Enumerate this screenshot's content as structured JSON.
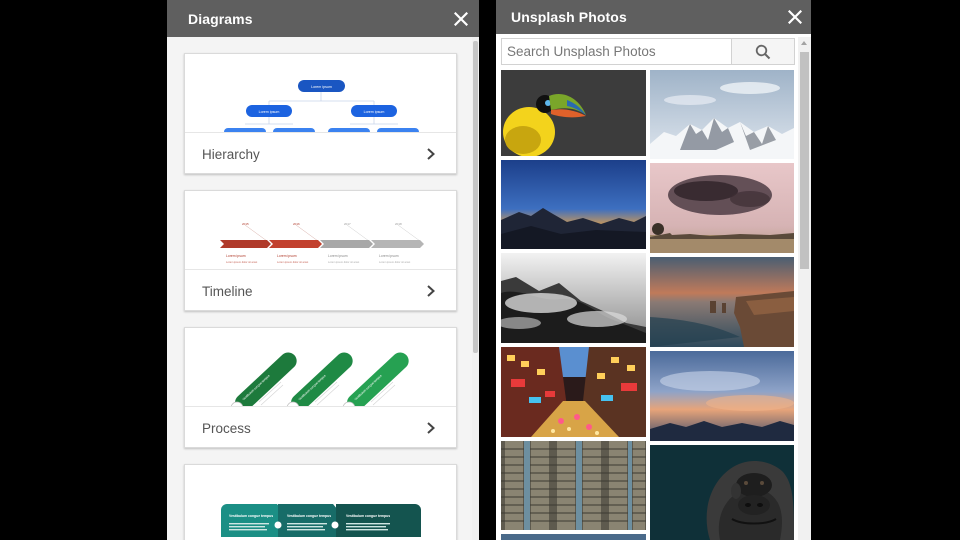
{
  "diagrams_panel": {
    "title": "Diagrams",
    "close_icon": "close-icon",
    "cards": [
      {
        "label": "Hierarchy",
        "preview": {
          "type": "hierarchy",
          "node_label": "Lorem ipsum",
          "color": "#1a56c2"
        }
      },
      {
        "label": "Timeline",
        "preview": {
          "type": "timeline",
          "step_label": "Lorem ipsum",
          "step_detail": "Lorem ipsum dolor sit amet",
          "active_color": "#b03a2a",
          "inactive_color": "#a8a8a8"
        }
      },
      {
        "label": "Process",
        "preview": {
          "type": "process",
          "step_title": "Vestibulum congue tempus",
          "color": "#1e7a3e"
        }
      },
      {
        "label": "",
        "preview": {
          "type": "steps",
          "step_title": "Vestibulum congue tempus",
          "color": "#1b6e6a"
        }
      }
    ],
    "chevron_icon": "chevron-right-icon"
  },
  "unsplash_panel": {
    "title": "Unsplash Photos",
    "close_icon": "close-icon",
    "search": {
      "placeholder": "Search Unsplash Photos",
      "value": "",
      "icon": "search-icon"
    },
    "photos": [
      {
        "id": "toucan",
        "column": "left"
      },
      {
        "id": "snowy-mountains",
        "column": "right"
      },
      {
        "id": "dusk-mountains",
        "column": "left"
      },
      {
        "id": "bird-murmuration",
        "column": "right"
      },
      {
        "id": "misty-forest",
        "column": "left"
      },
      {
        "id": "coastline-sunset",
        "column": "right"
      },
      {
        "id": "city-street-night",
        "column": "left"
      },
      {
        "id": "sunset-clouds",
        "column": "right"
      },
      {
        "id": "apartment-tower",
        "column": "left"
      },
      {
        "id": "gorilla",
        "column": "right"
      }
    ]
  }
}
